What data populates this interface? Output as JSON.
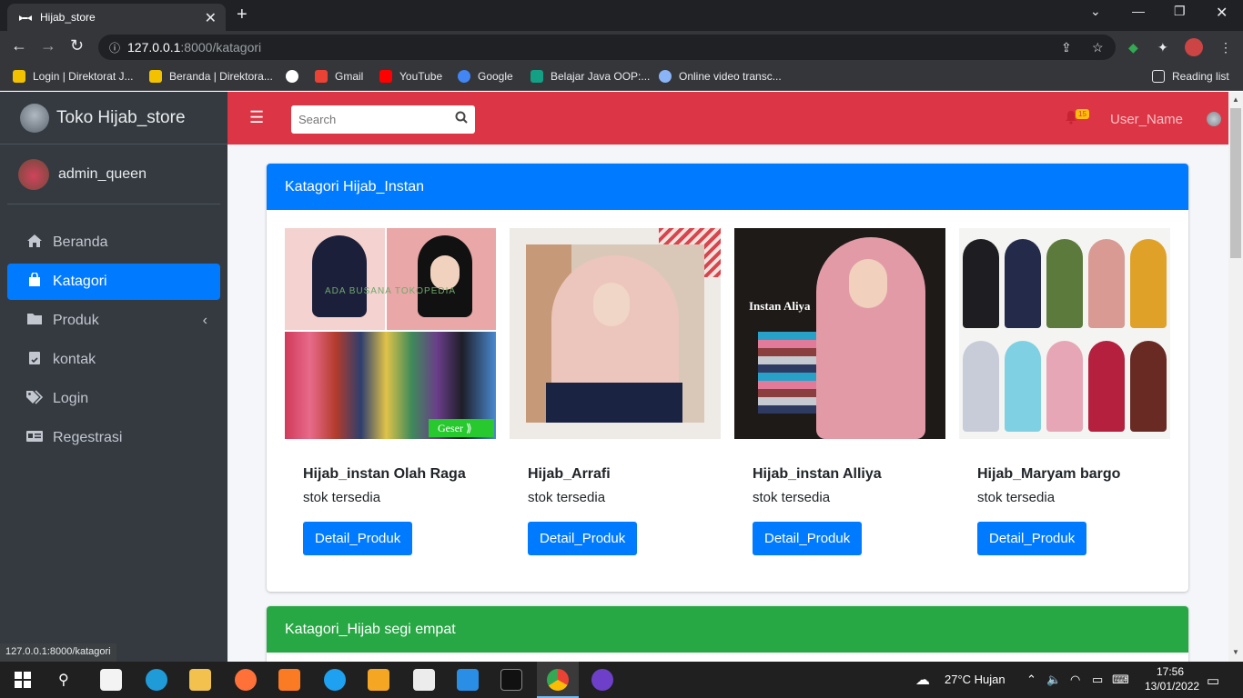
{
  "browser": {
    "tab_title": "Hijab_store",
    "url_host": "127.0.0.1",
    "url_path": ":8000/katagori",
    "bookmarks": [
      {
        "label": "Login | Direktorat J...",
        "color": "#f2c200"
      },
      {
        "label": "Beranda | Direktora...",
        "color": "#f2c200"
      },
      {
        "label": "",
        "color": "#ffffff"
      },
      {
        "label": "Gmail",
        "color": "#ea4335"
      },
      {
        "label": "YouTube",
        "color": "#ff0000"
      },
      {
        "label": "Google",
        "color": "#4285f4"
      },
      {
        "label": "Belajar Java OOP:...",
        "color": "#14a085"
      },
      {
        "label": "Online video transc...",
        "color": "#8ab4f8"
      }
    ],
    "reading_list": "Reading list",
    "status_url": "127.0.0.1:8000/katagori"
  },
  "sidebar": {
    "brand": "Toko Hijab_store",
    "user": "admin_queen",
    "items": [
      {
        "label": "Beranda",
        "icon": "home-icon",
        "glyph": "⌂"
      },
      {
        "label": "Katagori",
        "icon": "shopping-bag-icon",
        "glyph": "🛍"
      },
      {
        "label": "Produk",
        "icon": "folder-icon",
        "glyph": "▬"
      },
      {
        "label": "kontak",
        "icon": "contact-icon",
        "glyph": "☎"
      },
      {
        "label": "Login",
        "icon": "tags-icon",
        "glyph": "🏷"
      },
      {
        "label": "Regestrasi",
        "icon": "id-card-icon",
        "glyph": "▤"
      }
    ]
  },
  "topnav": {
    "search_placeholder": "Search",
    "notifications": "15",
    "username": "User_Name"
  },
  "sections": [
    {
      "title": "Katagori Hijab_Instan",
      "color": "#007bff",
      "products": [
        {
          "name": "Hijab_instan Olah Raga",
          "stock": "stok tersedia",
          "button": "Detail_Produk",
          "img_caption": "ADA BUSANA TOKOPEDIA",
          "img_badge": "Geser ⟫"
        },
        {
          "name": "Hijab_Arrafi",
          "stock": "stok tersedia",
          "button": "Detail_Produk",
          "img_caption": "",
          "img_badge": ""
        },
        {
          "name": "Hijab_instan Alliya",
          "stock": "stok tersedia",
          "button": "Detail_Produk",
          "img_caption": "Instan Aliya",
          "img_badge": ""
        },
        {
          "name": "Hijab_Maryam bargo",
          "stock": "stok tersedia",
          "button": "Detail_Produk",
          "img_caption": "",
          "img_badge": ""
        }
      ]
    },
    {
      "title": "Katagori_Hijab segi empat",
      "color": "#28a745"
    }
  ],
  "taskbar": {
    "weather": "27°C  Hujan",
    "time": "17:56",
    "date": "13/01/2022"
  }
}
